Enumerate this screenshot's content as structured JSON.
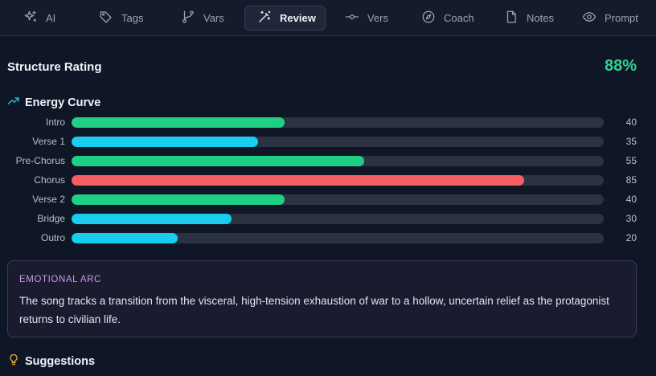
{
  "tabs": [
    {
      "label": "AI",
      "icon": "sparkles-icon",
      "active": false
    },
    {
      "label": "Tags",
      "icon": "tag-icon",
      "active": false
    },
    {
      "label": "Vars",
      "icon": "git-branch-icon",
      "active": false
    },
    {
      "label": "Review",
      "icon": "magic-wand-icon",
      "active": true
    },
    {
      "label": "Vers",
      "icon": "commit-icon",
      "active": false
    },
    {
      "label": "Coach",
      "icon": "compass-icon",
      "active": false
    },
    {
      "label": "Notes",
      "icon": "file-icon",
      "active": false
    },
    {
      "label": "Prompt",
      "icon": "eye-icon",
      "active": false
    }
  ],
  "structure": {
    "title": "Structure Rating",
    "value": "88%"
  },
  "energy": {
    "title": "Energy Curve",
    "icon": "trending-up-icon",
    "max": 100,
    "rows": [
      {
        "label": "Intro",
        "value": 40,
        "color": "#1fd084"
      },
      {
        "label": "Verse 1",
        "value": 35,
        "color": "#19cdef"
      },
      {
        "label": "Pre-Chorus",
        "value": 55,
        "color": "#1fd084"
      },
      {
        "label": "Chorus",
        "value": 85,
        "color": "#f55f64"
      },
      {
        "label": "Verse 2",
        "value": 40,
        "color": "#1fd084"
      },
      {
        "label": "Bridge",
        "value": 30,
        "color": "#19cdef"
      },
      {
        "label": "Outro",
        "value": 20,
        "color": "#19cdef"
      }
    ]
  },
  "emotional_arc": {
    "title": "EMOTIONAL ARC",
    "text": "The song tracks a transition from the visceral, high-tension exhaustion of war to a hollow, uncertain relief as the protagonist returns to civilian life."
  },
  "suggestions": {
    "title": "Suggestions",
    "icon": "lightbulb-icon"
  },
  "colors": {
    "accent_green": "#2fd18c",
    "accent_cyan": "#19cdef",
    "accent_red": "#f55f64",
    "arc_title": "#c79ae9",
    "bulb": "#f3b53a"
  }
}
